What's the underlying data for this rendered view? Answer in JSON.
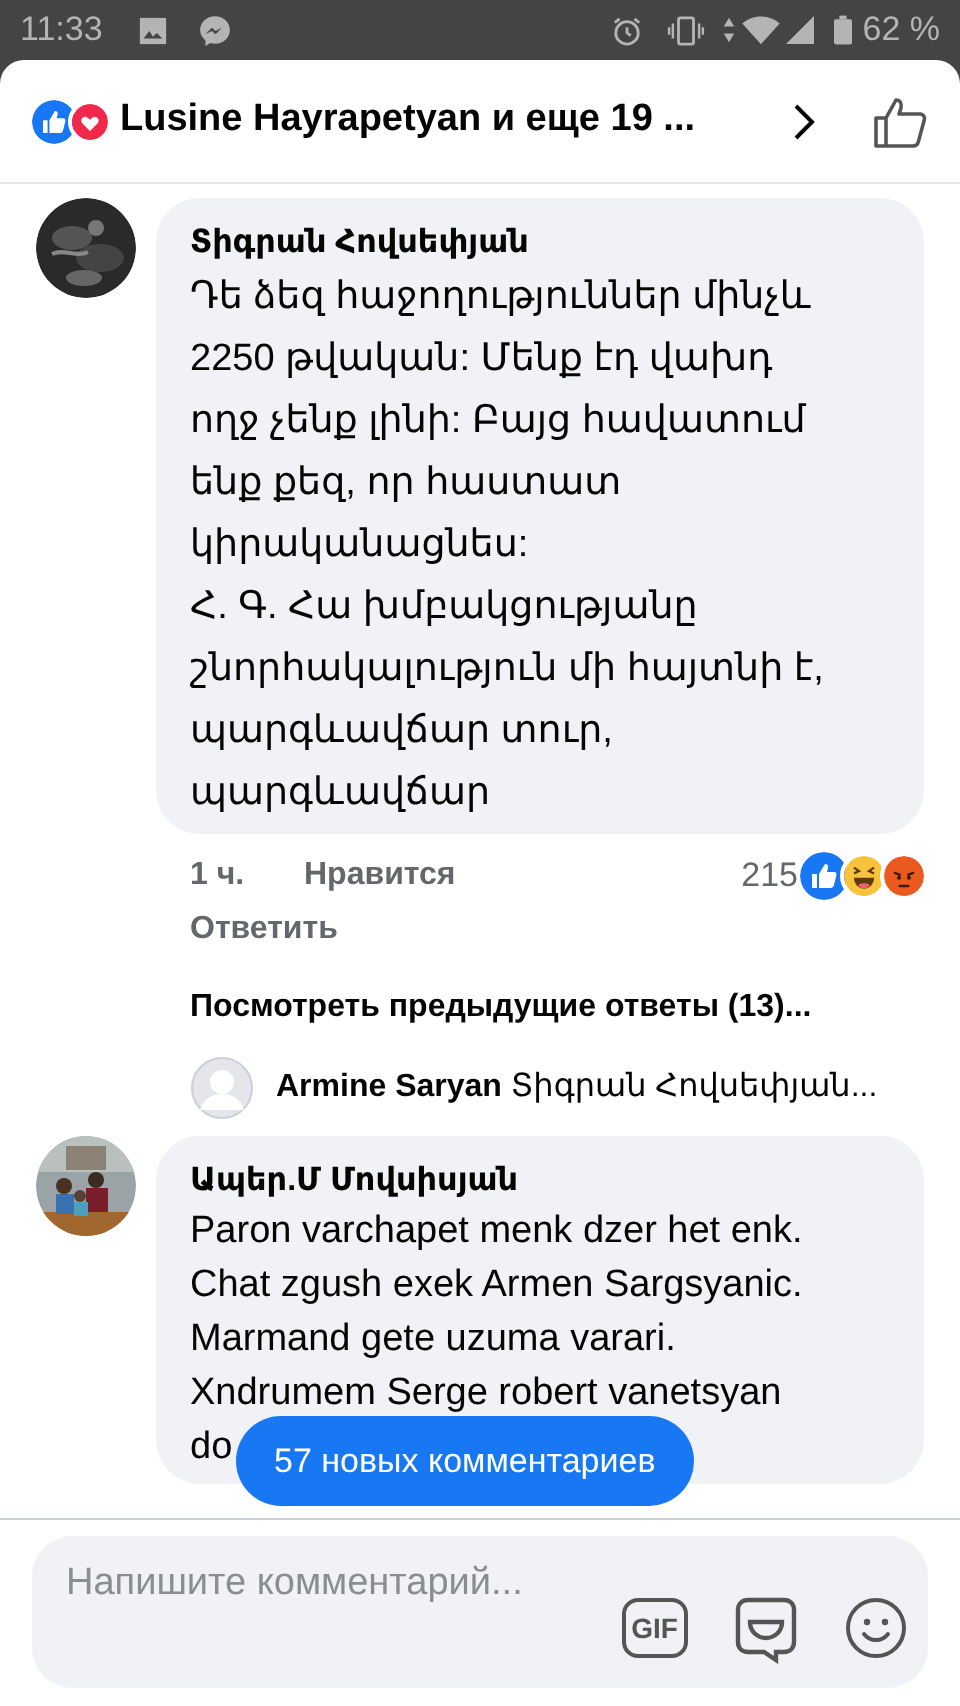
{
  "status_bar": {
    "time": "11:33",
    "battery": "62 %"
  },
  "header": {
    "reactions": [
      {
        "kind": "like"
      },
      {
        "kind": "love"
      }
    ],
    "title": "Lusine Hayrapetyan и еще 19 ..."
  },
  "comments": [
    {
      "author": "Տիգրան Հովսեփյան",
      "lines": [
        "Դե ձեզ հաջողություններ մինչև",
        "2250 թվական: Մենք էդ վախդ",
        "ողջ չենք լինի: Բայց հավատում",
        "ենք քեզ, որ հաստատ",
        "կիրականացնես:",
        "Հ. Գ. Հա խմբակցությանը",
        "շնորհակալություն մի հայտնի է,",
        "պարգևավճար տուր,",
        "պարգևավճար"
      ],
      "time": "1 ч.",
      "like": "Нравится",
      "reply": "Ответить",
      "reaction_count": "215",
      "reactions": [
        {
          "kind": "like"
        },
        {
          "kind": "haha"
        },
        {
          "kind": "angry"
        }
      ],
      "previous_replies": "Посмотреть предыдущие ответы (13)...",
      "reply_preview": {
        "author": "Armine Saryan",
        "text": "Տիգրան Հովսեփյան..."
      }
    },
    {
      "author": "Ապեր.Մ Մովսիսյան",
      "lines": [
        "Paron varchapet menk dzer het enk.",
        "Chat zgush exek Armen Sargsyanic.",
        "Marmand gete uzuma varari.",
        "Xndrumem Serge robert vanetsyan",
        "do"
      ]
    }
  ],
  "new_comments": "57 новых комментариев",
  "composer": {
    "placeholder": "Напишите комментарий...",
    "buttons": [
      {
        "kind": "gif",
        "label": "GIF"
      },
      {
        "kind": "sticker"
      },
      {
        "kind": "emoji"
      }
    ]
  }
}
